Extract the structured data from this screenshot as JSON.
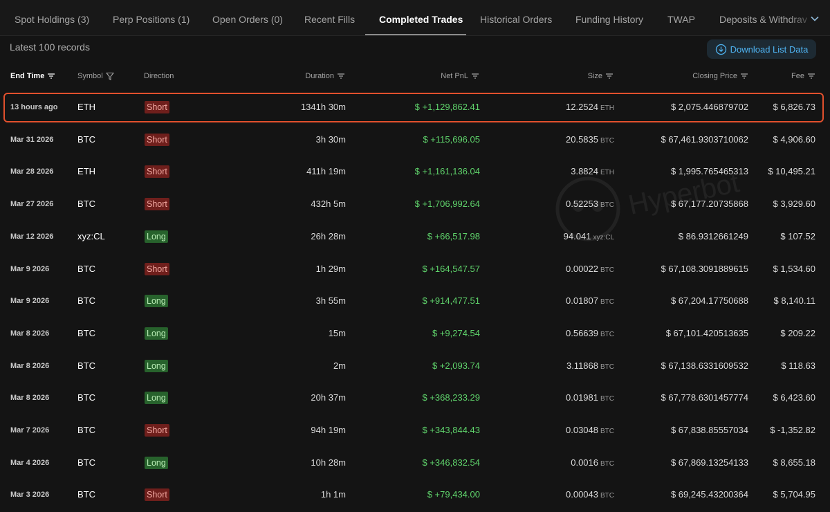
{
  "tabs": [
    {
      "label": "Spot Holdings (3)"
    },
    {
      "label": "Perp Positions (1)"
    },
    {
      "label": "Open Orders (0)"
    },
    {
      "label": "Recent Fills"
    },
    {
      "label": "Completed Trades"
    },
    {
      "label": "Historical Orders"
    },
    {
      "label": "Funding History"
    },
    {
      "label": "TWAP"
    },
    {
      "label": "Deposits & Withdrav"
    }
  ],
  "records_label": "Latest 100 records",
  "download_label": "Download List Data",
  "watermark_text": "Hyperbot",
  "headers": {
    "end_time": "End Time",
    "symbol": "Symbol",
    "direction": "Direction",
    "duration": "Duration",
    "net_pnl": "Net PnL",
    "size": "Size",
    "closing_price": "Closing Price",
    "fee": "Fee"
  },
  "colors": {
    "accent_blue": "#4fb3f1",
    "pnl_green": "#5fd36b",
    "short_badge": "#6f1f1c",
    "long_badge": "#27622c",
    "highlight_border": "#e2502d"
  },
  "rows": [
    {
      "time": "13 hours ago",
      "symbol": "ETH",
      "direction": "Short",
      "duration": "1341h 30m",
      "pnl": "$ +1,129,862.41",
      "size": "12.2524",
      "size_unit": "ETH",
      "closing_price": "$ 2,075.446879702",
      "fee": "$ 6,826.73"
    },
    {
      "time": "Mar 31 2026",
      "symbol": "BTC",
      "direction": "Short",
      "duration": "3h 30m",
      "pnl": "$ +115,696.05",
      "size": "20.5835",
      "size_unit": "BTC",
      "closing_price": "$ 67,461.9303710062",
      "fee": "$ 4,906.60"
    },
    {
      "time": "Mar 28 2026",
      "symbol": "ETH",
      "direction": "Short",
      "duration": "411h 19m",
      "pnl": "$ +1,161,136.04",
      "size": "3.8824",
      "size_unit": "ETH",
      "closing_price": "$ 1,995.765465313",
      "fee": "$ 10,495.21"
    },
    {
      "time": "Mar 27 2026",
      "symbol": "BTC",
      "direction": "Short",
      "duration": "432h 5m",
      "pnl": "$ +1,706,992.64",
      "size": "0.52253",
      "size_unit": "BTC",
      "closing_price": "$ 67,177.20735868",
      "fee": "$ 3,929.60"
    },
    {
      "time": "Mar 12 2026",
      "symbol": "xyz:CL",
      "direction": "Long",
      "duration": "26h 28m",
      "pnl": "$ +66,517.98",
      "size": "94.041",
      "size_unit": "xyz:CL",
      "closing_price": "$ 86.9312661249",
      "fee": "$ 107.52"
    },
    {
      "time": "Mar 9 2026",
      "symbol": "BTC",
      "direction": "Short",
      "duration": "1h 29m",
      "pnl": "$ +164,547.57",
      "size": "0.00022",
      "size_unit": "BTC",
      "closing_price": "$ 67,108.3091889615",
      "fee": "$ 1,534.60"
    },
    {
      "time": "Mar 9 2026",
      "symbol": "BTC",
      "direction": "Long",
      "duration": "3h 55m",
      "pnl": "$ +914,477.51",
      "size": "0.01807",
      "size_unit": "BTC",
      "closing_price": "$ 67,204.17750688",
      "fee": "$ 8,140.11"
    },
    {
      "time": "Mar 8 2026",
      "symbol": "BTC",
      "direction": "Long",
      "duration": "15m",
      "pnl": "$ +9,274.54",
      "size": "0.56639",
      "size_unit": "BTC",
      "closing_price": "$ 67,101.420513635",
      "fee": "$ 209.22"
    },
    {
      "time": "Mar 8 2026",
      "symbol": "BTC",
      "direction": "Long",
      "duration": "2m",
      "pnl": "$ +2,093.74",
      "size": "3.11868",
      "size_unit": "BTC",
      "closing_price": "$ 67,138.6331609532",
      "fee": "$ 118.63"
    },
    {
      "time": "Mar 8 2026",
      "symbol": "BTC",
      "direction": "Long",
      "duration": "20h 37m",
      "pnl": "$ +368,233.29",
      "size": "0.01981",
      "size_unit": "BTC",
      "closing_price": "$ 67,778.6301457774",
      "fee": "$ 6,423.60"
    },
    {
      "time": "Mar 7 2026",
      "symbol": "BTC",
      "direction": "Short",
      "duration": "94h 19m",
      "pnl": "$ +343,844.43",
      "size": "0.03048",
      "size_unit": "BTC",
      "closing_price": "$ 67,838.85557034",
      "fee": "$ -1,352.82"
    },
    {
      "time": "Mar 4 2026",
      "symbol": "BTC",
      "direction": "Long",
      "duration": "10h 28m",
      "pnl": "$ +346,832.54",
      "size": "0.0016",
      "size_unit": "BTC",
      "closing_price": "$ 67,869.13254133",
      "fee": "$ 8,655.18"
    },
    {
      "time": "Mar 3 2026",
      "symbol": "BTC",
      "direction": "Short",
      "duration": "1h 1m",
      "pnl": "$ +79,434.00",
      "size": "0.00043",
      "size_unit": "BTC",
      "closing_price": "$ 69,245.43200364",
      "fee": "$ 5,704.95"
    }
  ]
}
